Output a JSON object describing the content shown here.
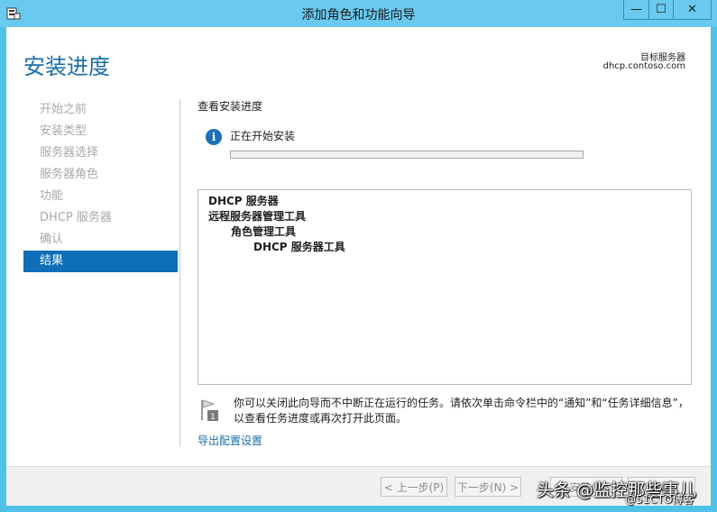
{
  "window": {
    "title": "添加角色和功能向导",
    "min_glyph": "—",
    "max_glyph": "☐",
    "close_glyph": "✕"
  },
  "page": {
    "title": "安装进度",
    "destination_label": "目标服务器",
    "destination_host": "dhcp.contoso.com"
  },
  "nav": {
    "items": [
      {
        "label": "开始之前"
      },
      {
        "label": "安装类型"
      },
      {
        "label": "服务器选择"
      },
      {
        "label": "服务器角色"
      },
      {
        "label": "功能"
      },
      {
        "label": "DHCP 服务器"
      },
      {
        "label": "确认"
      },
      {
        "label": "结果"
      }
    ],
    "active_index": 7
  },
  "main": {
    "heading": "查看安装进度",
    "status_icon": "info-icon",
    "status_text": "正在开始安装",
    "progress_fraction": 0.0,
    "features": [
      {
        "label": "DHCP 服务器",
        "level": 0
      },
      {
        "label": "远程服务器管理工具",
        "level": 0
      },
      {
        "label": "角色管理工具",
        "level": 1
      },
      {
        "label": "DHCP 服务器工具",
        "level": 2
      }
    ],
    "note_icon": "flag-notification-icon",
    "note_text": "你可以关闭此向导而不中断正在运行的任务。请依次单击命令栏中的“通知”和“任务详细信息”，以查看任务进度或再次打开此页面。",
    "export_link": "导出配置设置"
  },
  "footer": {
    "prev_label": "< 上一步(P)",
    "next_label": "下一步(N) >",
    "install_label": "安装(I)",
    "close_label": "关闭"
  },
  "watermark": {
    "line1": "头条 @监控那些事儿",
    "line2": "@51CTO博客"
  },
  "colors": {
    "accent": "#1b6ea8",
    "nav_active": "#0e6fb8",
    "titlebar": "#69c9ef",
    "border": "#4fc1e9"
  }
}
